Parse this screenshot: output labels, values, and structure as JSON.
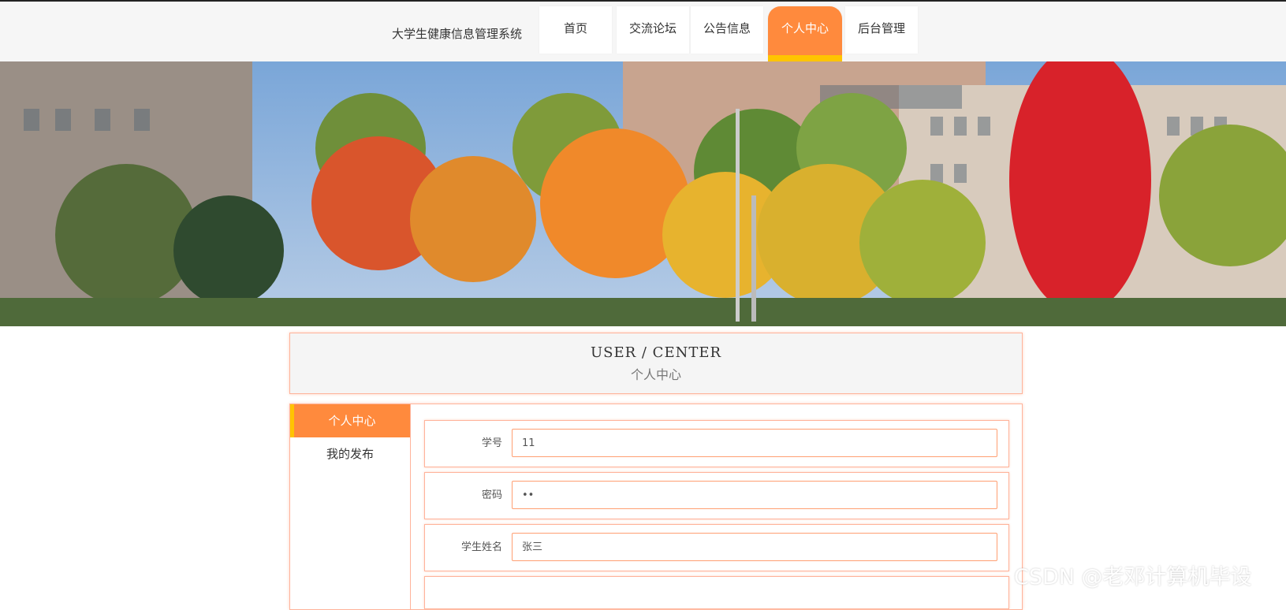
{
  "app": {
    "title": "大学生健康信息管理系统"
  },
  "nav": {
    "items": [
      {
        "label": "首页"
      },
      {
        "label": "交流论坛"
      },
      {
        "label": "公告信息"
      },
      {
        "label": "个人中心",
        "active": true
      },
      {
        "label": "后台管理"
      }
    ],
    "accent_color": "#ff8a3d",
    "underline_color": "#ffc400"
  },
  "banner": {
    "slides_count": 3,
    "active_index": 0
  },
  "header": {
    "title_en": "USER / CENTER",
    "title_cn": "个人中心"
  },
  "sidebar": {
    "items": [
      {
        "label": "个人中心",
        "active": true
      },
      {
        "label": "我的发布"
      }
    ]
  },
  "form": {
    "fields": [
      {
        "label": "学号",
        "value": "11"
      },
      {
        "label": "密码",
        "value": "••"
      },
      {
        "label": "学生姓名",
        "value": "张三"
      }
    ]
  },
  "watermark": {
    "text": "CSDN @老邓计算机毕设"
  }
}
